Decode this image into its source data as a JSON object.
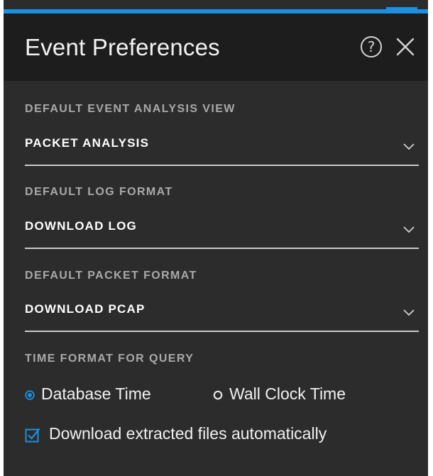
{
  "dialog": {
    "title": "Event Preferences",
    "help_icon": "question-circle-icon",
    "close_icon": "close-icon",
    "help_glyph": "?"
  },
  "fields": [
    {
      "label": "DEFAULT EVENT ANALYSIS VIEW",
      "value": "PACKET ANALYSIS"
    },
    {
      "label": "DEFAULT LOG FORMAT",
      "value": "DOWNLOAD LOG"
    },
    {
      "label": "DEFAULT PACKET FORMAT",
      "value": "DOWNLOAD PCAP"
    }
  ],
  "time_format": {
    "label": "TIME FORMAT FOR QUERY",
    "options": [
      {
        "label": "Database Time",
        "selected": true
      },
      {
        "label": "Wall Clock Time",
        "selected": false
      }
    ]
  },
  "auto_download": {
    "label": "Download extracted files automatically",
    "checked": true
  },
  "colors": {
    "accent": "#1d8fe0",
    "panel_bg": "#2c2c2c",
    "header_bg": "#1d1d1d"
  }
}
